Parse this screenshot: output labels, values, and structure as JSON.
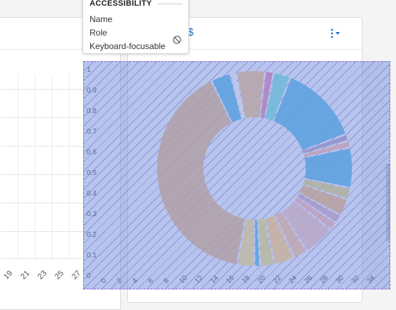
{
  "tooltip": {
    "title": "ACCESSIBILITY",
    "rows": [
      "Name",
      "Role",
      "Keyboard-focusable"
    ],
    "focusable_icon": "not-allowed-icon"
  },
  "left_chart": {
    "x_ticks": [
      "19",
      "21",
      "23",
      "25",
      "27"
    ]
  },
  "overlay_axis": {
    "y_ticks": [
      "1",
      "0.9",
      "0.8",
      "0.7",
      "0.6",
      "0.5",
      "0.4",
      "0.3",
      "0.2",
      "0.1",
      "0"
    ],
    "x_ticks": [
      "0",
      "2",
      "4",
      "6",
      "8",
      "10",
      "12",
      "14",
      "16",
      "18",
      "20",
      "22",
      "24",
      "26",
      "28",
      "30",
      "32",
      "34"
    ]
  },
  "header_icons": {
    "currency": "dollar-icon",
    "menu": "kebab-menu-icon"
  },
  "colors": {
    "accent": "#1a73c9",
    "overlay": "#7896dc",
    "hatch": "#8c5adc"
  },
  "chart_data": {
    "type": "pie",
    "slices": [
      {
        "value": 42.0,
        "color": "#b0a0a8"
      },
      {
        "value": 3.5,
        "color": "#5aa0e0"
      },
      {
        "value": 1.0,
        "color": "#c0c8e8"
      },
      {
        "value": 5.0,
        "color": "#b8a4a8"
      },
      {
        "value": 1.5,
        "color": "#b080c0"
      },
      {
        "value": 3.0,
        "color": "#70b8d8"
      },
      {
        "value": 14.0,
        "color": "#5aa0e0"
      },
      {
        "value": 1.2,
        "color": "#9090c8"
      },
      {
        "value": 1.2,
        "color": "#c0a0b8"
      },
      {
        "value": 7.0,
        "color": "#5aa0e0"
      },
      {
        "value": 2.0,
        "color": "#b0b0a0"
      },
      {
        "value": 3.0,
        "color": "#b8a0a0"
      },
      {
        "value": 1.5,
        "color": "#a898c8"
      },
      {
        "value": 1.5,
        "color": "#c0a0c0"
      },
      {
        "value": 5.5,
        "color": "#b8a8c8"
      },
      {
        "value": 2.5,
        "color": "#c0a8b0"
      },
      {
        "value": 3.5,
        "color": "#c8b0a0"
      },
      {
        "value": 2.5,
        "color": "#b8b8a0"
      },
      {
        "value": 1.0,
        "color": "#5aa0e0"
      },
      {
        "value": 3.0,
        "color": "#c0b8a8"
      }
    ]
  }
}
